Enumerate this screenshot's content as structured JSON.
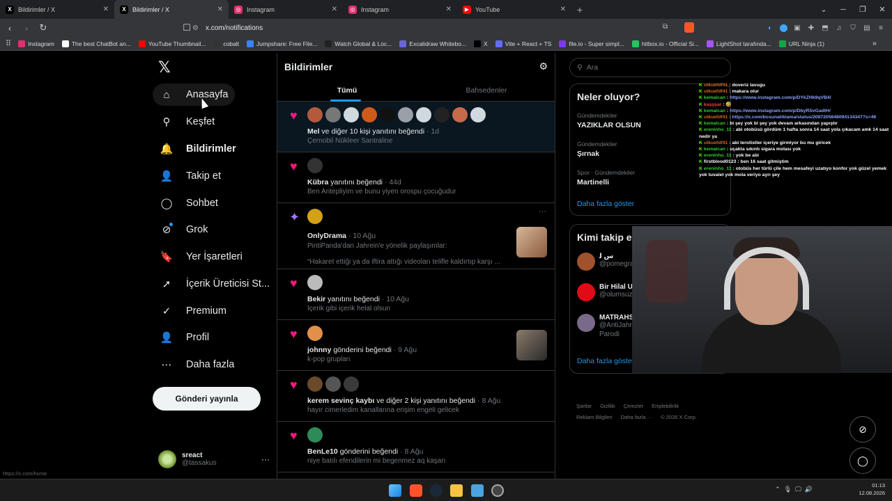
{
  "browser": {
    "tabs": [
      {
        "label": "Bildirimler / X",
        "icon": "x-logo-icon",
        "active": false
      },
      {
        "label": "Bildirimler / X",
        "icon": "x-logo-icon",
        "active": true
      },
      {
        "label": "Instagram",
        "icon": "instagram-icon",
        "active": false
      },
      {
        "label": "Instagram",
        "icon": "instagram-icon",
        "active": false
      },
      {
        "label": "YouTube",
        "icon": "youtube-icon",
        "active": false
      }
    ],
    "new_tab": "+",
    "url": "x.com/notifications",
    "status_url": "https://x.com/home",
    "bookmarks": [
      {
        "label": "Instagram",
        "color": "#e1306c"
      },
      {
        "label": "The best ChatBot an...",
        "color": "#ffffff"
      },
      {
        "label": "YouTube Thumbnail...",
        "color": "#ff0000"
      },
      {
        "label": "cobalt",
        "color": "#333333"
      },
      {
        "label": "Jumpshare: Free File...",
        "color": "#3b82f6"
      },
      {
        "label": "Watch Global & Loc...",
        "color": "#222222"
      },
      {
        "label": "Excalidraw Whitebo...",
        "color": "#6965db"
      },
      {
        "label": "X",
        "color": "#000000"
      },
      {
        "label": "Vite + React + TS",
        "color": "#646cff"
      },
      {
        "label": "file.io - Super simpl...",
        "color": "#7c3aed"
      },
      {
        "label": "hitbox.io - Official Si...",
        "color": "#22c55e"
      },
      {
        "label": "LightShot tarafında...",
        "color": "#a855f7"
      },
      {
        "label": "URL Ninja (1)",
        "color": "#16a34a"
      }
    ]
  },
  "sidebar": {
    "logo": "𝕏",
    "items": [
      {
        "label": "Anasayfa",
        "icon": "home-icon",
        "glyph": "⌂"
      },
      {
        "label": "Keşfet",
        "icon": "search-icon",
        "glyph": "⚲"
      },
      {
        "label": "Bildirimler",
        "icon": "bell-icon",
        "glyph": "🔔"
      },
      {
        "label": "Takip et",
        "icon": "add-user-icon",
        "glyph": "👤"
      },
      {
        "label": "Sohbet",
        "icon": "chat-icon",
        "glyph": "◯"
      },
      {
        "label": "Grok",
        "icon": "grok-icon",
        "glyph": "⊘"
      },
      {
        "label": "Yer İşaretleri",
        "icon": "bookmark-icon",
        "glyph": "🔖"
      },
      {
        "label": "İçerik Üreticisi St...",
        "icon": "rocket-icon",
        "glyph": "➚"
      },
      {
        "label": "Premium",
        "icon": "premium-icon",
        "glyph": "✓"
      },
      {
        "label": "Profil",
        "icon": "profile-icon",
        "glyph": "👤"
      },
      {
        "label": "Daha fazla",
        "icon": "more-circle-icon",
        "glyph": "⋯"
      }
    ],
    "post_button": "Gönderi yayınla",
    "account": {
      "name": "sreact",
      "handle": "@tassakus",
      "more": "···"
    }
  },
  "feed": {
    "title": "Bildirimler",
    "tabs": [
      "Tümü",
      "Bahsedenler"
    ],
    "notifications": [
      {
        "type": "like",
        "avatars": [
          "#b35a3c",
          "#777777",
          "#cfd9de",
          "#cf5a1b",
          "#111111",
          "#9aa0a6",
          "#cfd9de",
          "#222222",
          "#c56a4a",
          "#cfd9de"
        ],
        "actor": "Mel",
        "action": " ve diğer 10 kişi yanıtını beğendi",
        "time": "1d",
        "sub": "Çernobil Nükleer Santraline",
        "highlight": true,
        "thumb": false
      },
      {
        "type": "like",
        "avatars": [
          "#333333"
        ],
        "actor": "Kübra",
        "action": " yanıtını beğendi",
        "time": "44d",
        "sub": "Ben Antepliyim ve bunu yiyen orospu çocuğudur",
        "highlight": false,
        "thumb": false
      },
      {
        "type": "spark",
        "avatars": [
          "#d4a017"
        ],
        "actor": "OnlyDrama",
        "action": "",
        "time": "10 Ağu",
        "sub": "PintiPanda'dan Jahrein'e yönelik paylaşımlar:",
        "sub2": "“Hakaret ettiği ya da iftira attığı videoları telifle kaldırtıp karşı ...",
        "highlight": false,
        "thumb": true
      },
      {
        "type": "like",
        "avatars": [
          "#bbbbbb"
        ],
        "actor": "Bekir",
        "action": " yanıtını beğendi",
        "time": "10 Ağu",
        "sub": "İçerik gibi içerik helal olsun",
        "highlight": false,
        "thumb": false
      },
      {
        "type": "like",
        "avatars": [
          "#e0904a"
        ],
        "actor": "johnny",
        "action": " gönderini beğendi",
        "time": "9 Ağu",
        "sub": "k-pop grupları",
        "highlight": false,
        "thumb": true
      },
      {
        "type": "like",
        "avatars": [
          "#6b4a2a",
          "#555555",
          "#3a3a3a"
        ],
        "actor": "kerem sevinç kaybı",
        "action": " ve diğer 2 kişi yanıtını beğendi",
        "time": "8 Ağu",
        "sub": "hayır cimerledim kanallarına erişim engeli gelicek",
        "highlight": false,
        "thumb": false
      },
      {
        "type": "like",
        "avatars": [
          "#2e8b57"
        ],
        "actor": "BenLe10",
        "action": " gönderini beğendi",
        "time": "8 Ağu",
        "sub": "niye batılı efendilerin mi begenmez aq kaşarı",
        "highlight": false,
        "thumb": false
      }
    ]
  },
  "right": {
    "search_placeholder": "Ara",
    "trends_title": "Neler oluyor?",
    "trends": [
      {
        "category": "Gündemdekiler",
        "topic": "YAZIKLAR OLSUN"
      },
      {
        "category": "Gündemdekiler",
        "topic": "Şırnak"
      },
      {
        "category": "Spor · Gündemdekiler",
        "topic": "Martinelli"
      }
    ],
    "show_more": "Daha fazla göster",
    "who_title": "Kimi takip et",
    "who": [
      {
        "name": "س ﻟ",
        "handle": "@pomegra",
        "color": "#a0522d"
      },
      {
        "name": "Bir Hilal U",
        "handle": "@olumsuz",
        "color": "#e30a17"
      },
      {
        "name": "MATRAHS",
        "handle": "@AntiJahr",
        "extra": "Parodi",
        "color": "#7a6a8a"
      }
    ],
    "who_more": "Daha fazla göster",
    "footer": [
      "Şartlar",
      "Gizlilik",
      "Çerezler",
      "Erişilebilirlik",
      "Reklam Bilgileri",
      "Daha fazla ···",
      "© 2026 X Corp."
    ]
  },
  "chat": [
    {
      "user": "utkuefdf41",
      "ucolor": "#d2691e",
      "msg": "doveriz lavugu"
    },
    {
      "user": "utkuefdf41",
      "ucolor": "#d2691e",
      "msg": "makara olur"
    },
    {
      "user": "kemalcan",
      "ucolor": "#32cd32",
      "msg": "https://www.instagram.com/p/DYkZHk9qVB4/",
      "link": true
    },
    {
      "user": "kaşşşar",
      "ucolor": "#ff4040",
      "msg": "🤣"
    },
    {
      "user": "kemalcan",
      "ucolor": "#32cd32",
      "msg": "https://www.instagram.com/p/DbyRSvGadtH/",
      "link": true
    },
    {
      "user": "utkuefdf41",
      "ucolor": "#d2691e",
      "msg": "https://x.com/bosunatiklama/status/2087205648094134347?s=46",
      "link": true
    },
    {
      "user": "kemalcan",
      "ucolor": "#32cd32",
      "msg": "bi şey yok bi şey yok devam arkasından yapıştır"
    },
    {
      "user": "ereninho_11",
      "ucolor": "#32cd32",
      "msg": "abi otobüsü gördüm 1 hafta sonra 14 saat yola çıkacam amk 14 saat nedir ya"
    },
    {
      "user": "utkuefdf41",
      "ucolor": "#d2691e",
      "msg": "abi terotistler içeriye girmiyor bu mu giricek"
    },
    {
      "user": "kemalcan",
      "ucolor": "#32cd32",
      "msg": "uçakta sıkıntı sigara molası yok"
    },
    {
      "user": "ereninho_11",
      "ucolor": "#32cd32",
      "msg": "yok be abi"
    },
    {
      "user": "firstblood0123",
      "ucolor": "#ffffff",
      "msg": "ben 16 saat gitmiştim"
    },
    {
      "user": "ereninho_11",
      "ucolor": "#32cd32",
      "msg": "otobüs her türlü çile hem mesafeyi uzatıyo konfor yok güzel yemek yok tuvalet yok mola veriyo ayrı şey"
    }
  ],
  "taskbar": {
    "time": "01:13",
    "date": "12.08.2026"
  }
}
